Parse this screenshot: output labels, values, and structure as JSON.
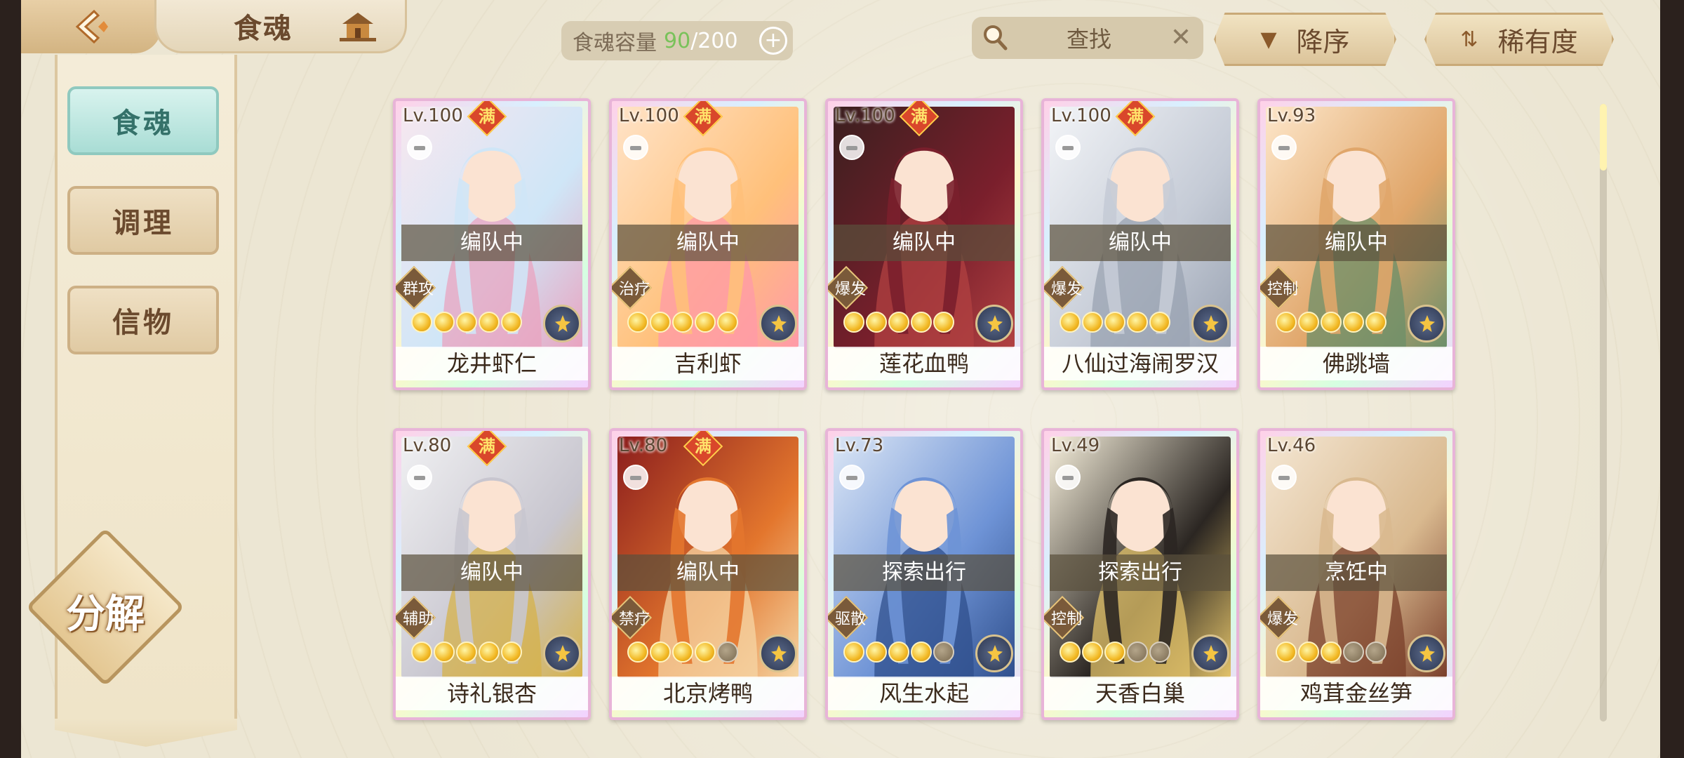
{
  "header": {
    "title": "食魂",
    "capacity": {
      "label": "食魂容量",
      "current": "90",
      "separator": "/",
      "max": "200",
      "plus": "+"
    },
    "search": {
      "placeholder": "查找",
      "clear": "✕"
    },
    "sort_button": "降序",
    "filter_button": "稀有度"
  },
  "sidebar": {
    "tabs": [
      {
        "label": "食魂",
        "active": true
      },
      {
        "label": "调理",
        "active": false
      },
      {
        "label": "信物",
        "active": false
      }
    ],
    "decompose": "分解"
  },
  "cards": [
    {
      "level": "Lv.100",
      "full": "满",
      "status": "编队中",
      "role": "群攻",
      "stars": 5,
      "name": "龙井虾仁",
      "palette": [
        "#f7e7ef",
        "#cfe6f7",
        "#e9a3bf"
      ]
    },
    {
      "level": "Lv.100",
      "full": "满",
      "status": "编队中",
      "role": "治疗",
      "stars": 5,
      "name": "吉利虾",
      "palette": [
        "#ffe3c7",
        "#ffc07a",
        "#ff9aa8"
      ]
    },
    {
      "level": "Lv.100",
      "full": "满",
      "status": "编队中",
      "role": "爆发",
      "stars": 5,
      "name": "莲花血鸭",
      "palette": [
        "#3a1f1f",
        "#7a1f2c",
        "#b24242"
      ]
    },
    {
      "level": "Lv.100",
      "full": "满",
      "status": "编队中",
      "role": "爆发",
      "stars": 5,
      "name": "八仙过海闹罗汉",
      "palette": [
        "#f2f4f7",
        "#c5cbd6",
        "#9aa3b2"
      ]
    },
    {
      "level": "Lv.93",
      "full": "",
      "status": "编队中",
      "role": "控制",
      "stars": 5,
      "name": "佛跳墙",
      "palette": [
        "#fde6c9",
        "#e0a66a",
        "#6b8f6a"
      ]
    },
    {
      "level": "Lv.80",
      "full": "满",
      "status": "编队中",
      "role": "辅助",
      "stars": 5,
      "name": "诗礼银杏",
      "palette": [
        "#f0f0f2",
        "#c8c6cf",
        "#d6b24a"
      ]
    },
    {
      "level": "Lv.80",
      "full": "满",
      "status": "编队中",
      "role": "禁疗",
      "stars": 4,
      "name": "北京烤鸭",
      "palette": [
        "#8b1d1d",
        "#e3762d",
        "#f5d6a5"
      ]
    },
    {
      "level": "Lv.73",
      "full": "",
      "status": "探索出行",
      "role": "驱散",
      "stars": 4,
      "name": "风生水起",
      "palette": [
        "#dbe6f5",
        "#6e93d6",
        "#2f4f8c"
      ]
    },
    {
      "level": "Lv.49",
      "full": "",
      "status": "探索出行",
      "role": "控制",
      "stars": 3,
      "name": "天香白巢",
      "palette": [
        "#f7f0dc",
        "#2b2622",
        "#e3c36a"
      ]
    },
    {
      "level": "Lv.46",
      "full": "",
      "status": "烹饪中",
      "role": "爆发",
      "stars": 3,
      "name": "鸡茸金丝笋",
      "palette": [
        "#f4e6d2",
        "#d9b98f",
        "#7a3f2a"
      ]
    }
  ],
  "colors": {
    "accent_teal": "#a9ddd5",
    "capacity_current": "#79c25a",
    "full_badge": "#d9472b"
  }
}
